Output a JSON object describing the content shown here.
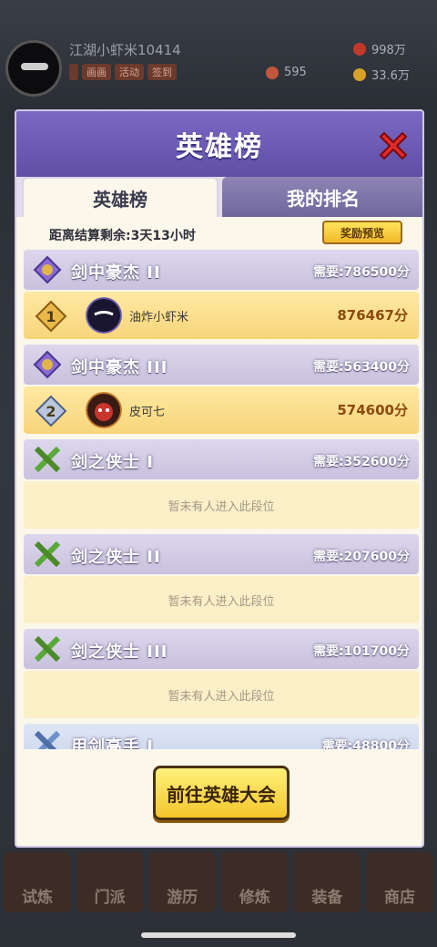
{
  "background": {
    "player_name": "江湖小虾米10414",
    "tags": [
      "",
      "画画",
      "活动",
      "签到"
    ],
    "resources": [
      {
        "icon": "gem-icon",
        "value": "998万"
      },
      {
        "icon": "ticket-icon",
        "value": "595"
      },
      {
        "icon": "coin-icon",
        "value": "33.6万"
      }
    ],
    "bottom_tabs": [
      "试炼",
      "门派",
      "游历",
      "修炼",
      "装备",
      "商店"
    ]
  },
  "modal": {
    "title": "英雄榜",
    "close_icon": "close-icon",
    "tabs": [
      {
        "label": "英雄榜",
        "active": true
      },
      {
        "label": "我的排名",
        "active": false
      }
    ],
    "timer_text": "距离结算剩余:3天13小时",
    "reward_button": "奖励预览",
    "tiers": [
      {
        "name": "剑中豪杰 II",
        "requirement": "需要:786500分",
        "icon": "purple-gem-icon",
        "style": "purple",
        "player": {
          "rank": "1",
          "name": "油炸小虾米",
          "score": "876467分",
          "avatar": "ninja-avatar-icon"
        }
      },
      {
        "name": "剑中豪杰 III",
        "requirement": "需要:563400分",
        "icon": "purple-gem-icon",
        "style": "purple",
        "player": {
          "rank": "2",
          "name": "皮可七",
          "score": "574600分",
          "avatar": "warrior-avatar-icon"
        }
      },
      {
        "name": "剑之侠士 I",
        "requirement": "需要:352600分",
        "icon": "green-swords-icon",
        "style": "purple",
        "empty_text": "暂未有人进入此段位"
      },
      {
        "name": "剑之侠士 II",
        "requirement": "需要:207600分",
        "icon": "green-swords-icon",
        "style": "purple",
        "empty_text": "暂未有人进入此段位"
      },
      {
        "name": "剑之侠士 III",
        "requirement": "需要:101700分",
        "icon": "green-swords-icon",
        "style": "purple",
        "empty_text": "暂未有人进入此段位"
      },
      {
        "name": "用剑高手 I",
        "requirement": "需要:48800分",
        "icon": "blue-swords-icon",
        "style": "blue"
      }
    ],
    "go_button": "前往英雄大会"
  }
}
